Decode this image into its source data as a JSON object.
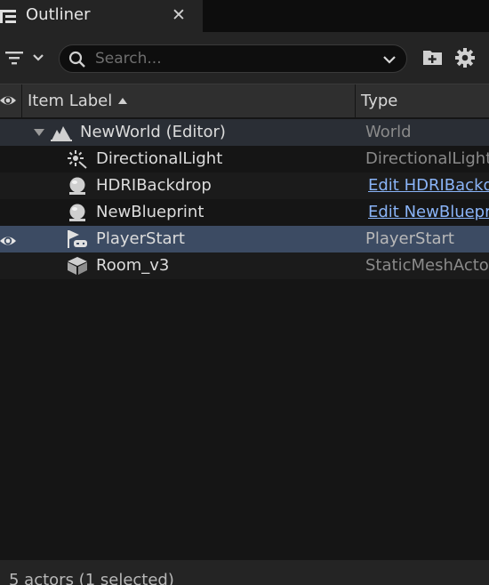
{
  "panel": {
    "title": "Outliner",
    "close_glyph": "✕"
  },
  "toolbar": {
    "filter_icon": "filter-icon",
    "search": {
      "placeholder": "Search...",
      "value": ""
    },
    "add_folder_icon": "add-folder-icon",
    "settings_icon": "gear-icon"
  },
  "columns": {
    "visibility_icon": "eye-icon",
    "item_label": "Item Label",
    "type": "Type",
    "sort": "ascending"
  },
  "rows": [
    {
      "label": "NewWorld (Editor)",
      "type": "World",
      "icon": "world-icon",
      "expanded": true
    },
    {
      "label": "DirectionalLight",
      "type": "DirectionalLight",
      "icon": "directional-light-icon"
    },
    {
      "label": "HDRIBackdrop",
      "type": "Edit HDRIBackdrop",
      "icon": "blueprint-sphere-icon",
      "type_is_link": true
    },
    {
      "label": "NewBlueprint",
      "type": "Edit NewBlueprint",
      "icon": "blueprint-sphere-icon",
      "type_is_link": true
    },
    {
      "label": "PlayerStart",
      "type": "PlayerStart",
      "icon": "player-start-icon",
      "selected": true
    },
    {
      "label": "Room_v3",
      "type": "StaticMeshActor",
      "icon": "static-mesh-icon"
    }
  ],
  "footer": {
    "status": "5 actors (1 selected)"
  },
  "colors": {
    "background": "#151515",
    "selection": "#3c4b63",
    "link": "#8ab4f8"
  }
}
